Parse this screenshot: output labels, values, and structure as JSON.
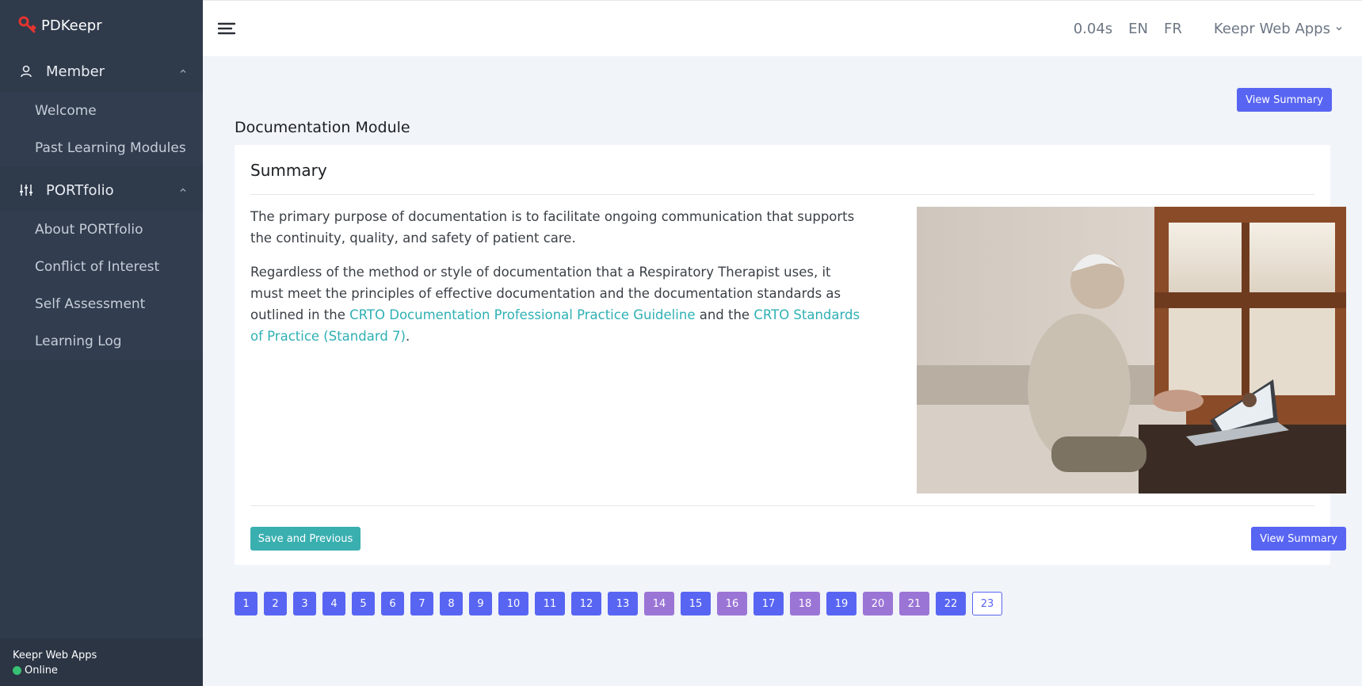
{
  "brand": {
    "name": "PDKeepr",
    "logo_icon": "key-icon",
    "logo_color": "#e3342f"
  },
  "sidebar": {
    "groups": [
      {
        "label": "Member",
        "icon": "user-icon",
        "items": [
          "Welcome",
          "Past Learning Modules"
        ]
      },
      {
        "label": "PORTfolio",
        "icon": "sliders-icon",
        "items": [
          "About PORTfolio",
          "Conflict of Interest",
          "Self Assessment",
          "Learning Log"
        ]
      }
    ],
    "footer": {
      "app_name": "Keepr Web Apps",
      "status": "Online",
      "status_color": "#38c172"
    }
  },
  "topbar": {
    "timing": "0.04s",
    "lang_en": "EN",
    "lang_fr": "FR",
    "app_menu": "Keepr Web Apps"
  },
  "main": {
    "view_summary_label": "View Summary",
    "page_title": "Documentation Module",
    "card": {
      "title": "Summary",
      "paragraph1": "The primary purpose of documentation is to facilitate ongoing communication that supports the continuity, quality, and safety of patient care.",
      "paragraph2_before": "Regardless of the method or style of documentation that a Respiratory Therapist uses, it must meet the principles of effective documentation and the documentation standards as outlined in the ",
      "link1": "CRTO Documentation Professional Practice Guideline",
      "paragraph2_middle": " and the ",
      "link2": "CRTO Standards of Practice (Standard 7)",
      "paragraph2_after": ".",
      "save_previous_label": "Save and Previous",
      "accent_link_color": "#2fb0b4"
    },
    "pagination": [
      {
        "label": "1",
        "state": "blue"
      },
      {
        "label": "2",
        "state": "blue"
      },
      {
        "label": "3",
        "state": "blue"
      },
      {
        "label": "4",
        "state": "blue"
      },
      {
        "label": "5",
        "state": "blue"
      },
      {
        "label": "6",
        "state": "blue"
      },
      {
        "label": "7",
        "state": "blue"
      },
      {
        "label": "8",
        "state": "blue"
      },
      {
        "label": "9",
        "state": "blue"
      },
      {
        "label": "10",
        "state": "blue"
      },
      {
        "label": "11",
        "state": "blue"
      },
      {
        "label": "12",
        "state": "blue"
      },
      {
        "label": "13",
        "state": "blue"
      },
      {
        "label": "14",
        "state": "purple"
      },
      {
        "label": "15",
        "state": "blue"
      },
      {
        "label": "16",
        "state": "purple"
      },
      {
        "label": "17",
        "state": "blue"
      },
      {
        "label": "18",
        "state": "purple"
      },
      {
        "label": "19",
        "state": "blue"
      },
      {
        "label": "20",
        "state": "purple"
      },
      {
        "label": "21",
        "state": "purple"
      },
      {
        "label": "22",
        "state": "blue"
      },
      {
        "label": "23",
        "state": "current"
      }
    ],
    "colors": {
      "primary": "#5865f2",
      "completed": "#9b75d6",
      "teal": "#3aafb0"
    }
  }
}
